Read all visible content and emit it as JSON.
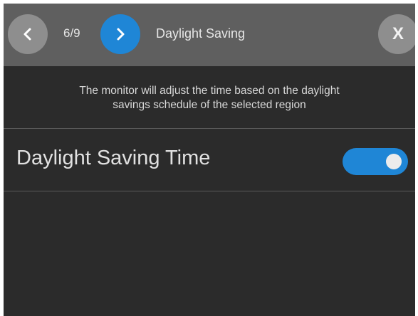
{
  "header": {
    "prev_glyph": "<",
    "next_glyph": ">",
    "page_counter": "6/9",
    "title": "Daylight Saving",
    "close_glyph": "X",
    "icons": {
      "prev": "chevron-left-icon",
      "next": "chevron-right-icon",
      "close": "close-icon"
    }
  },
  "description": {
    "line1": "The monitor will adjust the time based on the daylight",
    "line2": "savings schedule of the selected region"
  },
  "setting": {
    "label": "Daylight Saving Time",
    "enabled": true
  },
  "colors": {
    "accent": "#1f86d6",
    "header_bg": "#5f5f5f",
    "panel_bg": "#2b2b2b",
    "secondary_button": "#8e8e8e"
  }
}
